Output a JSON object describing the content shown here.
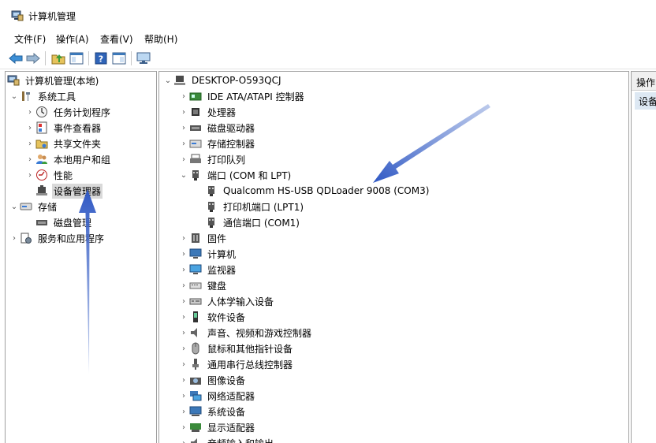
{
  "window": {
    "title": "计算机管理"
  },
  "menubar": {
    "items": [
      "文件(F)",
      "操作(A)",
      "查看(V)",
      "帮助(H)"
    ]
  },
  "toolbar": {
    "buttons": [
      "back-icon",
      "forward-icon",
      "up-folder-icon",
      "show-hide-tree-icon",
      "help-icon",
      "properties-icon",
      "monitor-icon"
    ]
  },
  "left_tree": {
    "root": "计算机管理(本地)",
    "system_tools": "系统工具",
    "task_scheduler": "任务计划程序",
    "event_viewer": "事件查看器",
    "shared_folders": "共享文件夹",
    "local_users": "本地用户和组",
    "performance": "性能",
    "device_manager": "设备管理器",
    "storage": "存储",
    "disk_management": "磁盘管理",
    "services_apps": "服务和应用程序"
  },
  "device_tree": {
    "computer": "DESKTOP-O593QCJ",
    "categories": [
      "IDE ATA/ATAPI 控制器",
      "处理器",
      "磁盘驱动器",
      "存储控制器",
      "打印队列",
      "端口 (COM 和 LPT)"
    ],
    "ports": [
      "Qualcomm HS-USB QDLoader 9008 (COM3)",
      "打印机端口 (LPT1)",
      "通信端口 (COM1)"
    ],
    "categories_after": [
      "固件",
      "计算机",
      "监视器",
      "键盘",
      "人体学输入设备",
      "软件设备",
      "声音、视频和游戏控制器",
      "鼠标和其他指针设备",
      "通用串行总线控制器",
      "图像设备",
      "网络适配器",
      "系统设备",
      "显示适配器",
      "音频输入和输出"
    ]
  },
  "actions_pane": {
    "header": "操作",
    "item": "设备"
  },
  "colors": {
    "annotation_arrow": "#3a5fc8",
    "selection": "#d9d9d9"
  }
}
